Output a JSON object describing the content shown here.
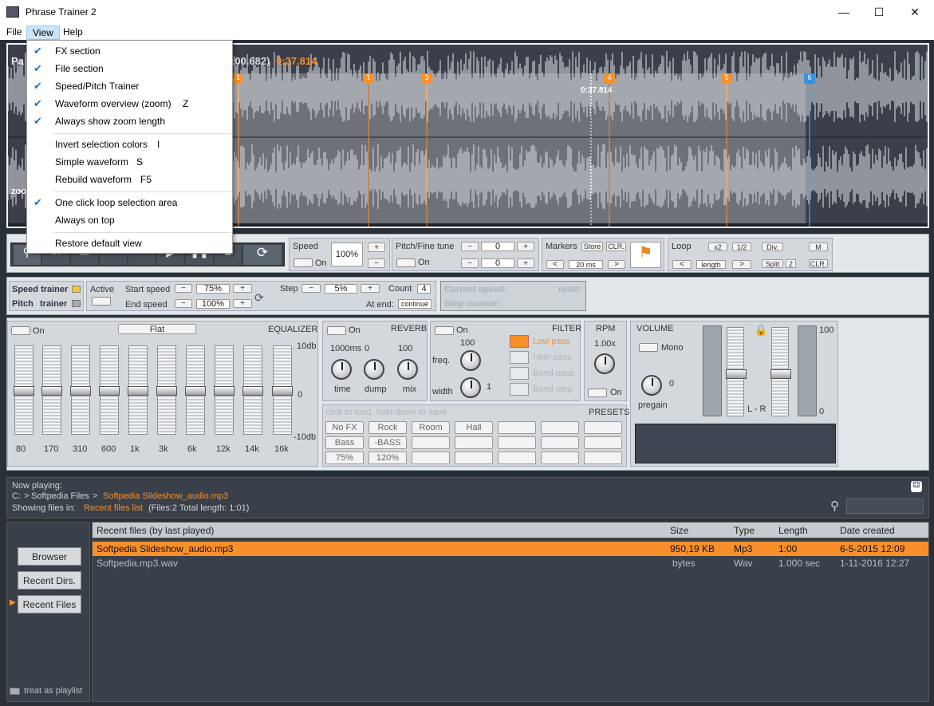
{
  "window": {
    "title": "Phrase Trainer 2"
  },
  "menu": [
    "File",
    "View",
    "Help"
  ],
  "view_menu": [
    {
      "label": "FX section",
      "checked": true,
      "key": ""
    },
    {
      "label": "File section",
      "checked": true,
      "key": ""
    },
    {
      "label": "Speed/Pitch Trainer",
      "checked": true,
      "key": ""
    },
    {
      "label": "Waveform overview (zoom)",
      "checked": true,
      "key": "Z"
    },
    {
      "label": "Always show zoom length",
      "checked": true,
      "key": ""
    },
    {
      "label": "Invert selection colors",
      "checked": false,
      "key": "I"
    },
    {
      "label": "Simple waveform",
      "checked": false,
      "key": "S"
    },
    {
      "label": "Rebuild waveform",
      "checked": false,
      "key": "F5"
    },
    {
      "label": "One click loop selection area",
      "checked": true,
      "key": ""
    },
    {
      "label": "Always on top",
      "checked": false,
      "key": ""
    },
    {
      "label": "Restore default view",
      "checked": false,
      "key": ""
    }
  ],
  "wave": {
    "title_prefix": "Pa",
    "time_range": ":00.682)",
    "time_current": "0:37.814",
    "cursor_time": "0:37.814",
    "zoom_label": "zoo",
    "markers": [
      "1",
      "1",
      "3",
      "4",
      "5",
      "6"
    ]
  },
  "speed": {
    "label": "Speed",
    "value": "100%",
    "on": "On"
  },
  "pitch": {
    "label": "Pitch/Fine tune",
    "value": "0",
    "fine": "0",
    "on": "On"
  },
  "markers": {
    "label": "Markers",
    "store": "Store",
    "clr": "CLR.",
    "ms": "20 ms"
  },
  "loop": {
    "label": "Loop",
    "x2": "x2",
    "half": "1/2",
    "div": "Div.",
    "m": "M",
    "length": "length",
    "split": "Split",
    "split_val": "2",
    "clr": "CLR."
  },
  "trainer": {
    "speed_trainer": "Speed trainer",
    "pitch": "Pitch",
    "trainer": "trainer",
    "active": "Active",
    "start_speed": "Start speed",
    "start_val": "75%",
    "end_speed": "End  speed",
    "end_val": "100%",
    "step": "Step",
    "step_val": "5%",
    "count": "Count",
    "count_val": "4",
    "at_end": "At end:",
    "continue": "continue",
    "current_speed": "Current speed:",
    "reset": "reset",
    "step_counter": "Step counter:"
  },
  "eq": {
    "on": "On",
    "preset": "Flat",
    "label": "EQUALIZER",
    "db_top": "10db",
    "db_mid": "0",
    "db_bot": "-10db",
    "bands": [
      "80",
      "170",
      "310",
      "600",
      "1k",
      "3k",
      "6k",
      "12k",
      "14k",
      "16k"
    ],
    "levels": [
      0.5,
      0.5,
      0.5,
      0.5,
      0.5,
      0.5,
      0.5,
      0.5,
      0.5,
      0.5
    ]
  },
  "reverb": {
    "on": "On",
    "label": "REVERB",
    "time_val": "1000ms",
    "dump_val": "0",
    "mix_val": "100",
    "time": "time",
    "dump": "dump",
    "mix": "mix"
  },
  "filter": {
    "on": "On",
    "label": "FILTER",
    "freq_val": "100",
    "width_val": "1",
    "freq": "freq.",
    "width": "width",
    "types": [
      "Low pass",
      "High pass",
      "Band pass",
      "Band stop"
    ],
    "active": "Low pass"
  },
  "rpm": {
    "label": "RPM",
    "value": "1.00x",
    "on": "On"
  },
  "volume": {
    "label": "VOLUME",
    "mono": "Mono",
    "pregain": "pregain",
    "pregain_val": "0",
    "lr": "L - R",
    "top": "100",
    "bottom": "0"
  },
  "presets": {
    "hint": "click to load, hold down to save",
    "label": "PRESETS",
    "row1": [
      "No FX",
      "Rock",
      "Room",
      "Hall",
      "",
      "",
      ""
    ],
    "row2": [
      "Bass",
      "-BASS",
      "",
      "",
      "",
      "",
      ""
    ],
    "row3": [
      "75%",
      "120%",
      "",
      "",
      "",
      "",
      ""
    ]
  },
  "nowplaying": {
    "label": "Now playing:",
    "path_drive": "C:",
    "sep1": ">",
    "folder": "Softpedia Files",
    "sep2": ">",
    "file": "Softpedia Slideshow_audio.mp3",
    "showing": "Showing files in:",
    "list": "Recent files list",
    "info": "(Files:2  Total length: 1:01)"
  },
  "sidebar": {
    "browser": "Browser",
    "recent_dirs": "Recent Dirs.",
    "recent_files": "Recent Files",
    "playlist": "treat as playlist"
  },
  "table": {
    "headers": [
      "Recent files (by last played)",
      "Size",
      "Type",
      "Length",
      "Date created"
    ],
    "rows": [
      {
        "name": "Softpedia Slideshow_audio.mp3",
        "size": "950,19 KB",
        "type": "Mp3",
        "length": "1:00",
        "date": "6-5-2015  12:09"
      },
      {
        "name": "Softpedia.mp3.wav",
        "size": "bytes",
        "type": "Wav",
        "length": "1.000 sec",
        "date": "1-11-2016  12:27"
      }
    ]
  },
  "colors": {
    "accent": "#f7902a",
    "marker_blue": "#3a8ee0",
    "bg": "#2b2f38"
  }
}
